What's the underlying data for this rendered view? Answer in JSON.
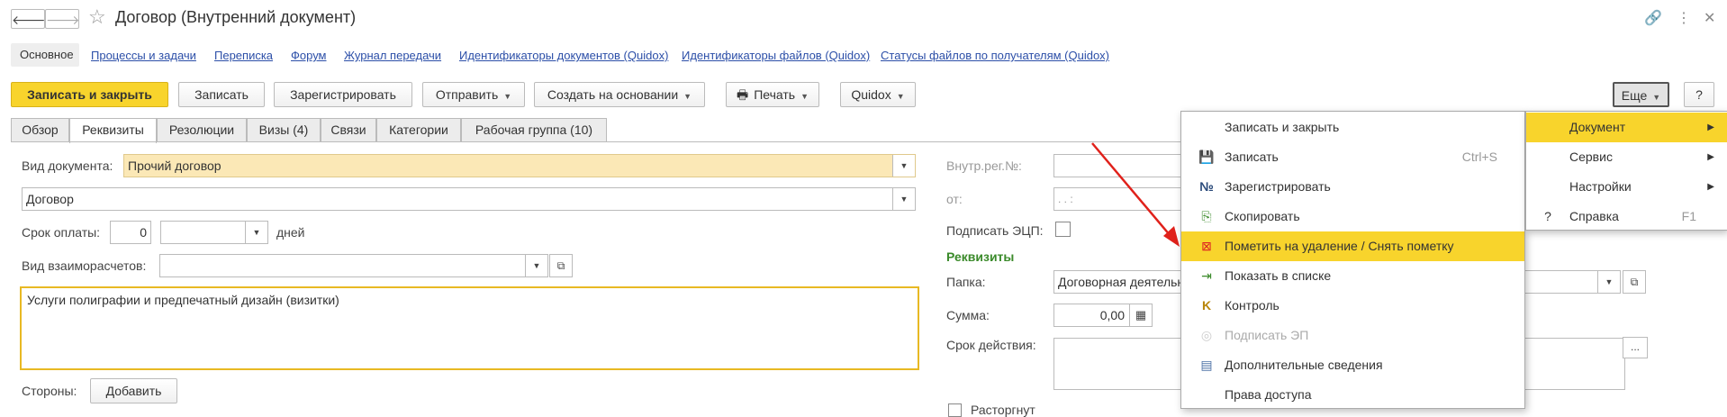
{
  "window": {
    "title": "Договор (Внутренний документ)",
    "back_icon": "arrow-left-icon",
    "forward_icon": "arrow-right-icon",
    "star_icon": "star-icon",
    "link_icon": "link-icon",
    "more_icon": "more-vertical-icon",
    "close_icon": "close-icon"
  },
  "section_tabs": [
    {
      "label": "Основное",
      "active": true
    },
    {
      "label": "Процессы и задачи"
    },
    {
      "label": "Переписка"
    },
    {
      "label": "Форум"
    },
    {
      "label": "Журнал передачи"
    },
    {
      "label": "Идентификаторы документов (Quidox)"
    },
    {
      "label": "Идентификаторы файлов (Quidox)"
    },
    {
      "label": "Статусы файлов по получателям (Quidox)"
    }
  ],
  "toolbar": {
    "save_close": "Записать и закрыть",
    "save": "Записать",
    "register": "Зарегистрировать",
    "send": "Отправить",
    "create_based": "Создать на основании",
    "print": "Печать",
    "quidox": "Quidox",
    "more": "Еще",
    "help": "?"
  },
  "form_tabs": [
    "Обзор",
    "Реквизиты",
    "Резолюции",
    "Визы (4)",
    "Связи",
    "Категории",
    "Рабочая группа (10)"
  ],
  "form": {
    "doc_type_label": "Вид документа:",
    "doc_type_value": "Прочий договор",
    "subtype_value": "Договор",
    "payment_term_label": "Срок оплаты:",
    "payment_term_value": "0",
    "days_label": "дней",
    "settlement_label": "Вид взаиморасчетов:",
    "subject_text": "Услуги полиграфии и предпечатный дизайн (визитки)",
    "parties_label": "Стороны:",
    "add_button": "Добавить",
    "internal_reg_label": "Внутр.рег.№:",
    "from_label": "от:",
    "date_placeholder": ". .   :",
    "sign_ecp_label": "Подписать ЭЦП:",
    "requisites_header": "Реквизиты",
    "folder_label": "Папка:",
    "folder_value": "Договорная деятельность",
    "sum_label": "Сумма:",
    "sum_value": "0,00",
    "validity_label": "Срок действия:",
    "terminated_label": "Расторгнут"
  },
  "context_menu": [
    {
      "label": "Записать и закрыть",
      "icon": ""
    },
    {
      "label": "Записать",
      "icon": "floppy-disk-icon",
      "shortcut": "Ctrl+S"
    },
    {
      "label": "Зарегистрировать",
      "icon": "number-sign-icon"
    },
    {
      "label": "Скопировать",
      "icon": "copy-document-icon"
    },
    {
      "label": "Пометить на удаление / Снять пометку",
      "icon": "mark-delete-icon",
      "selected": true
    },
    {
      "label": "Показать в списке",
      "icon": "show-in-list-icon"
    },
    {
      "label": "Контроль",
      "icon": "control-k-icon"
    },
    {
      "label": "Подписать ЭП",
      "icon": "sign-ep-icon",
      "disabled": true
    },
    {
      "label": "Дополнительные сведения",
      "icon": "info-sheet-icon"
    },
    {
      "label": "Права доступа",
      "icon": ""
    }
  ],
  "submenu": [
    {
      "label": "Документ",
      "selected": true
    },
    {
      "label": "Сервис"
    },
    {
      "label": "Настройки"
    },
    {
      "label": "Справка",
      "icon": "?",
      "shortcut": "F1"
    }
  ],
  "colors": {
    "accent_yellow": "#f8d42c",
    "link_blue": "#2c4fa8",
    "requisites_green": "#3a8a2a",
    "arrow_red": "#e0211b"
  }
}
